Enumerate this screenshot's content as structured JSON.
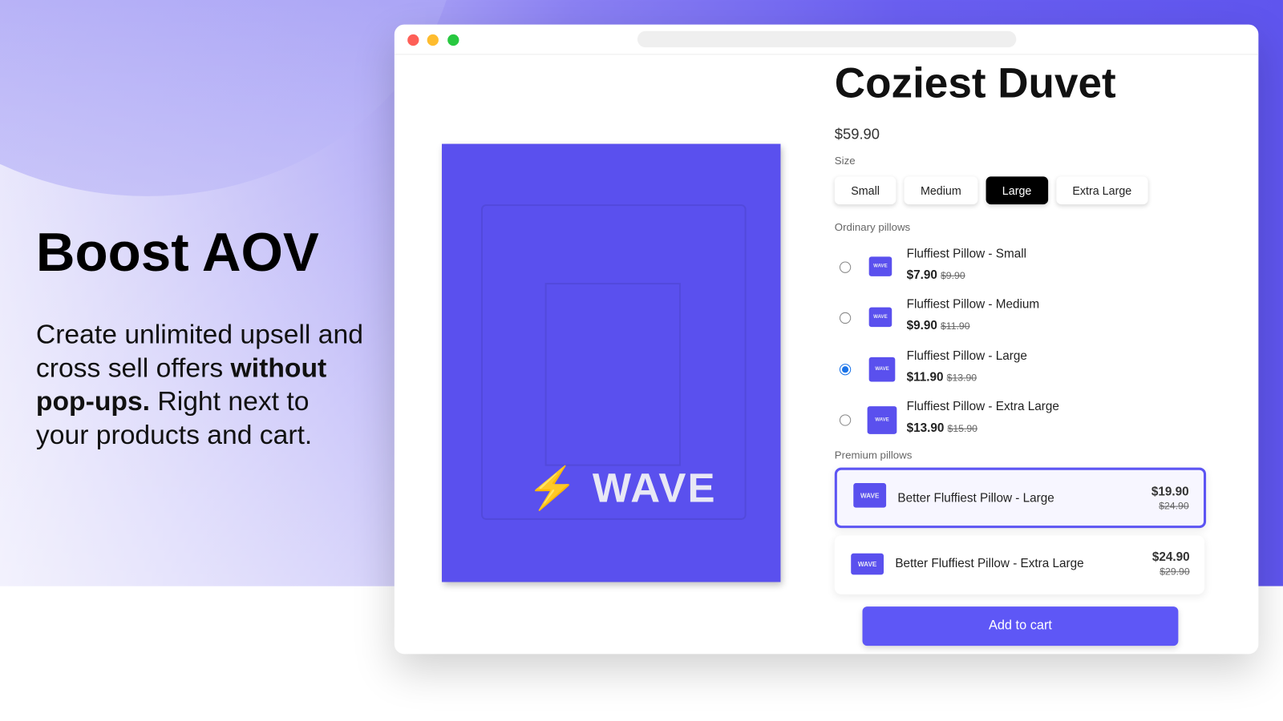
{
  "hero": {
    "title": "Boost AOV",
    "text_before": "Create unlimited upsell and cross sell offers ",
    "text_bold": "without pop-ups.",
    "text_after": " Right next to your products and cart."
  },
  "colors": {
    "accent": "#5e57f6",
    "product": "#5a50ee",
    "selected_radio": "#1a73e8"
  },
  "product": {
    "title": "Coziest Duvet",
    "image_logo": "WAVE",
    "price": "$59.90",
    "size_label": "Size",
    "sizes": [
      {
        "label": "Small"
      },
      {
        "label": "Medium"
      },
      {
        "label": "Large",
        "selected": true
      },
      {
        "label": "Extra Large"
      }
    ],
    "ordinary_label": "Ordinary pillows",
    "ordinary": [
      {
        "name": "Fluffiest Pillow - Small",
        "price": "$7.90",
        "old": "$9.90",
        "selected": false
      },
      {
        "name": "Fluffiest Pillow - Medium",
        "price": "$9.90",
        "old": "$11.90",
        "selected": false
      },
      {
        "name": "Fluffiest Pillow - Large",
        "price": "$11.90",
        "old": "$13.90",
        "selected": true
      },
      {
        "name": "Fluffiest Pillow - Extra Large",
        "price": "$13.90",
        "old": "$15.90",
        "selected": false
      }
    ],
    "premium_label": "Premium pillows",
    "premium": [
      {
        "name": "Better Fluffiest Pillow - Large",
        "price": "$19.90",
        "old": "$24.90",
        "selected": true
      },
      {
        "name": "Better Fluffiest Pillow - Extra Large",
        "price": "$24.90",
        "old": "$29.90",
        "selected": false
      }
    ],
    "thumb_logo": "WAVE",
    "add_to_cart": "Add to cart"
  }
}
